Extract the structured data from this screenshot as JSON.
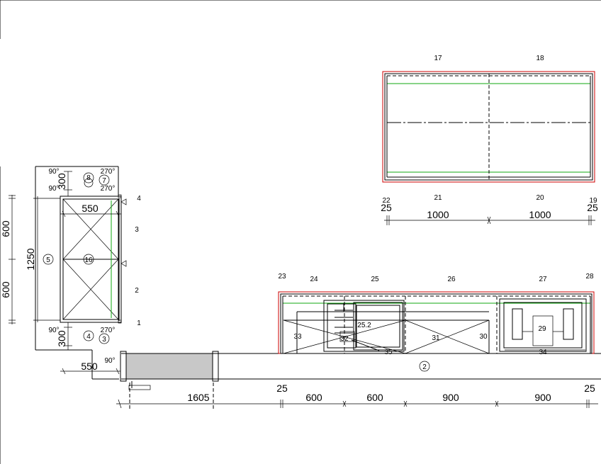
{
  "labels": {
    "l17": "17",
    "l18": "18",
    "l22": "22",
    "l21": "21",
    "l20": "20",
    "l19": "19",
    "top_d_left": "25",
    "top_d_1000a": "1000",
    "top_d_1000b": "1000",
    "top_d_right": "25",
    "l23": "23",
    "l24": "24",
    "l25": "25",
    "l26": "26",
    "l27": "27",
    "l28": "28",
    "l33": "33",
    "l32": "32",
    "l25_2": "25.2",
    "l35": "35",
    "l31": "31",
    "l30": "30",
    "l29": "29",
    "l34": "34",
    "l2_circle": "2",
    "left_d_550_top": "550",
    "left_d_1250": "1250",
    "left_d_600a": "600",
    "left_d_600b": "600",
    "left_d_300_top": "300",
    "left_d_300_bot": "300",
    "left_d_550_bot": "550",
    "l5": "5",
    "l16": "16",
    "l8": "8",
    "l7": "7",
    "l4": "4",
    "l3": "3",
    "side4": "4",
    "side3": "3",
    "side2": "2",
    "side1": "1",
    "deg90_a": "90°",
    "deg270_a": "270°",
    "deg90_b": "90°",
    "deg270_b": "270°",
    "deg90_c": "90°",
    "deg270_c": "270°",
    "deg90_d": "90°",
    "bot_d_1605": "1605",
    "bot_d_25a": "25",
    "bot_d_600a": "600",
    "bot_d_600b": "600",
    "bot_d_900a": "900",
    "bot_d_900b": "900",
    "bot_d_25b": "25"
  },
  "colors": {
    "outline": "#000000",
    "edge_red": "#cc0000",
    "inner_green": "#11aa11",
    "fill_grey": "#c8c8c8"
  }
}
